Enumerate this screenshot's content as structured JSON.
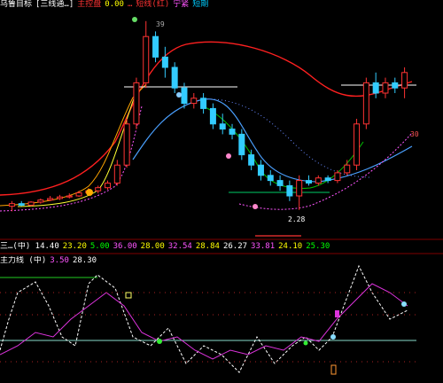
{
  "header_top": {
    "items": [
      {
        "text": "乌鲁目标",
        "color": "#ffffff"
      },
      {
        "text": "[三线通…]",
        "color": "#ffffff"
      },
      {
        "text": "主控盘",
        "color": "#ff3333"
      },
      {
        "text": "0.00",
        "color": "#ffff00"
      },
      {
        "text": "…",
        "color": "#ff3333"
      },
      {
        "text": "短线(红)",
        "color": "#ff3333"
      },
      {
        "text": "宁紧",
        "color": "#ff55ff"
      },
      {
        "text": "短期",
        "color": "#00ccff"
      }
    ]
  },
  "header_mid": {
    "items": [
      {
        "text": "三…(中) 14.40",
        "color": "#ffffff"
      },
      {
        "text": "23.20",
        "color": "#ffff00"
      },
      {
        "text": "5.00",
        "color": "#00ff00"
      },
      {
        "text": "36.00",
        "color": "#ff55ff"
      },
      {
        "text": "28.00",
        "color": "#ffff00"
      },
      {
        "text": "32.54",
        "color": "#ff55ff"
      },
      {
        "text": "28.84",
        "color": "#ffff00"
      },
      {
        "text": "26.27",
        "color": "#ffffff"
      },
      {
        "text": "33.81",
        "color": "#ff55ff"
      },
      {
        "text": "24.10",
        "color": "#ffff00"
      },
      {
        "text": "25.30",
        "color": "#00ff00"
      }
    ]
  },
  "header_low": {
    "items": [
      {
        "text": "主力线 (中)",
        "color": "#ffffff"
      },
      {
        "text": "3.50",
        "color": "#ff55ff"
      },
      {
        "text": "28.30",
        "color": "#ffffff"
      }
    ]
  },
  "chart_data": {
    "type": "candlestick",
    "annotations": {
      "high_label": "39",
      "low_label": "2.28",
      "right_label": "30"
    },
    "ylim": [
      0,
      40
    ],
    "candles": [
      {
        "o": 3,
        "h": 4,
        "l": 2,
        "c": 3.5
      },
      {
        "o": 3.5,
        "h": 4,
        "l": 3,
        "c": 3.2
      },
      {
        "o": 3.2,
        "h": 4,
        "l": 3,
        "c": 3.8
      },
      {
        "o": 3.8,
        "h": 4.5,
        "l": 3.5,
        "c": 4.2
      },
      {
        "o": 4.2,
        "h": 5,
        "l": 4,
        "c": 4.5
      },
      {
        "o": 4.5,
        "h": 5.2,
        "l": 4.2,
        "c": 4.8
      },
      {
        "o": 4.8,
        "h": 5.5,
        "l": 4.5,
        "c": 5.0
      },
      {
        "o": 5.0,
        "h": 6,
        "l": 4.8,
        "c": 5.6
      },
      {
        "o": 5.6,
        "h": 6.5,
        "l": 5.2,
        "c": 6.0
      },
      {
        "o": 6.0,
        "h": 7,
        "l": 5.5,
        "c": 6.6
      },
      {
        "o": 6.6,
        "h": 8,
        "l": 6.2,
        "c": 7.5
      },
      {
        "o": 7.5,
        "h": 12,
        "l": 7,
        "c": 11
      },
      {
        "o": 11,
        "h": 20,
        "l": 10.5,
        "c": 19
      },
      {
        "o": 19,
        "h": 28,
        "l": 18,
        "c": 27
      },
      {
        "o": 27,
        "h": 39,
        "l": 26,
        "c": 36
      },
      {
        "o": 36,
        "h": 37,
        "l": 31,
        "c": 32
      },
      {
        "o": 32,
        "h": 34,
        "l": 28,
        "c": 30
      },
      {
        "o": 30,
        "h": 31,
        "l": 25,
        "c": 26
      },
      {
        "o": 26,
        "h": 27,
        "l": 22,
        "c": 23
      },
      {
        "o": 23,
        "h": 25,
        "l": 22,
        "c": 24
      },
      {
        "o": 24,
        "h": 25,
        "l": 21,
        "c": 22
      },
      {
        "o": 22,
        "h": 23,
        "l": 18,
        "c": 19
      },
      {
        "o": 19,
        "h": 21,
        "l": 17,
        "c": 18
      },
      {
        "o": 18,
        "h": 19,
        "l": 16,
        "c": 17
      },
      {
        "o": 17,
        "h": 18,
        "l": 12,
        "c": 13
      },
      {
        "o": 13,
        "h": 14,
        "l": 10,
        "c": 11
      },
      {
        "o": 11,
        "h": 12,
        "l": 8,
        "c": 9
      },
      {
        "o": 9,
        "h": 10,
        "l": 7,
        "c": 8
      },
      {
        "o": 8,
        "h": 9,
        "l": 6,
        "c": 7
      },
      {
        "o": 7,
        "h": 8,
        "l": 4,
        "c": 5
      },
      {
        "o": 5,
        "h": 9,
        "l": 2.28,
        "c": 8
      },
      {
        "o": 8,
        "h": 9,
        "l": 7,
        "c": 7.5
      },
      {
        "o": 7.5,
        "h": 9,
        "l": 7,
        "c": 8.5
      },
      {
        "o": 8.5,
        "h": 9,
        "l": 7.5,
        "c": 8
      },
      {
        "o": 8,
        "h": 10,
        "l": 7.5,
        "c": 9.5
      },
      {
        "o": 9.5,
        "h": 12,
        "l": 9,
        "c": 11
      },
      {
        "o": 11,
        "h": 20,
        "l": 10,
        "c": 19
      },
      {
        "o": 19,
        "h": 28,
        "l": 18,
        "c": 27
      },
      {
        "o": 27,
        "h": 29,
        "l": 24,
        "c": 25
      },
      {
        "o": 25,
        "h": 28,
        "l": 24,
        "c": 27
      },
      {
        "o": 27,
        "h": 28,
        "l": 25,
        "c": 26
      },
      {
        "o": 26,
        "h": 30,
        "l": 24,
        "c": 29
      }
    ]
  }
}
